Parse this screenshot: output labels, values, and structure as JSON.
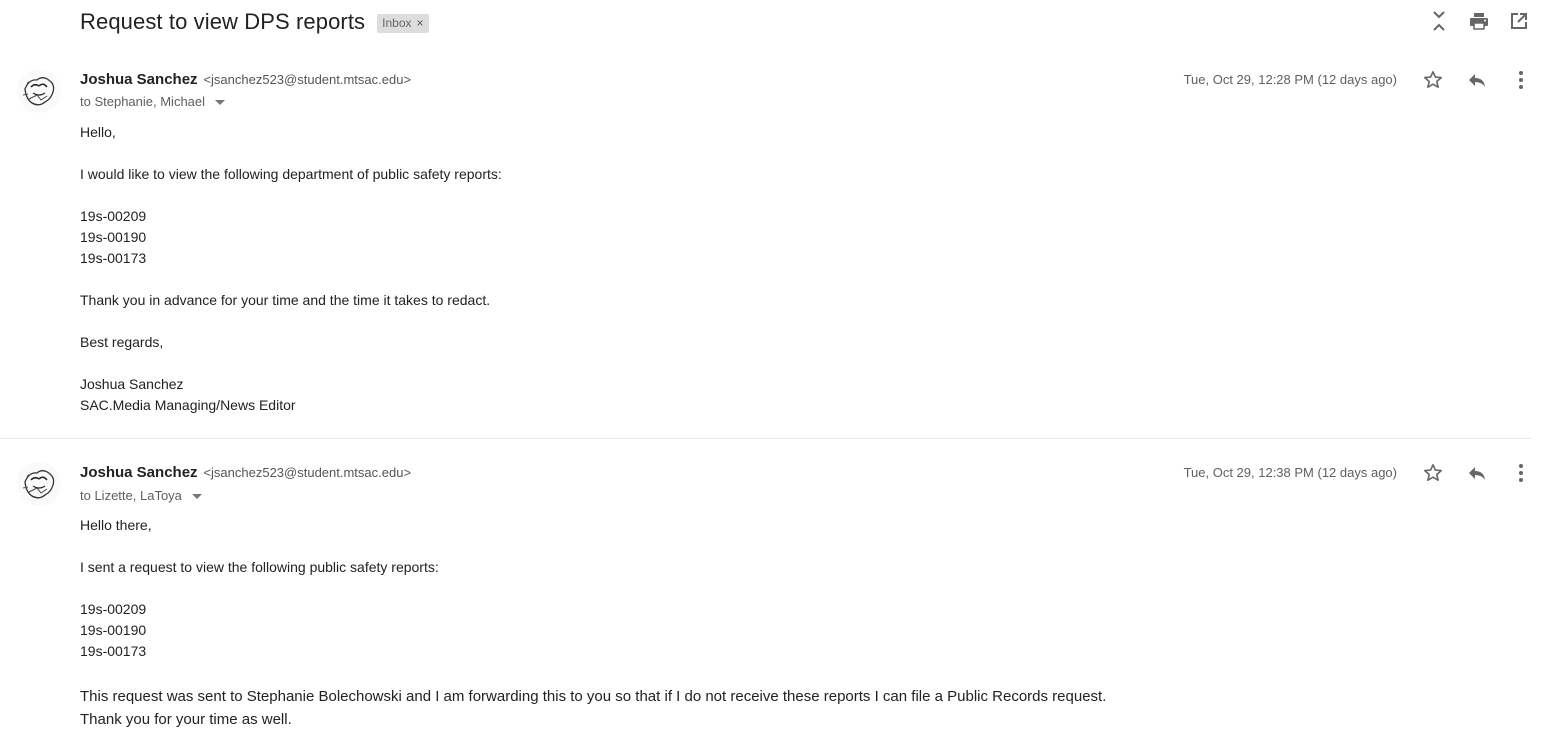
{
  "thread": {
    "subject": "Request to view DPS reports",
    "label": "Inbox"
  },
  "messages": [
    {
      "sender_name": "Joshua Sanchez",
      "sender_email": "<jsanchez523@student.mtsac.edu>",
      "to": "to Stephanie, Michael",
      "date": "Tue, Oct 29, 12:28 PM (12 days ago)",
      "body": {
        "greeting": "Hello,",
        "intro": "I would like to view the following department of public safety reports:",
        "reports": [
          "19s-00209",
          "19s-00190",
          "19s-00173"
        ],
        "thanks": "Thank you in advance for your time and the time it takes to redact.",
        "closing": "Best regards,",
        "signature_name": "Joshua Sanchez",
        "signature_title": "SAC.Media Managing/News Editor"
      }
    },
    {
      "sender_name": "Joshua Sanchez",
      "sender_email": "<jsanchez523@student.mtsac.edu>",
      "to": "to Lizette, LaToya",
      "date": "Tue, Oct 29, 12:38 PM (12 days ago)",
      "body": {
        "greeting": "Hello there,",
        "intro": "I sent a request to view the following public safety reports:",
        "reports": [
          "19s-00209",
          "19s-00190",
          "19s-00173"
        ],
        "line1": "This request was sent to Stephanie Bolechowski and I am forwarding this to you so that if I do not receive these reports I can file a Public Records request.",
        "line2": "Thank you for your time as well."
      }
    }
  ],
  "icons": {
    "collapse": "collapse-all-icon",
    "print": "print-icon",
    "open_new": "open-in-new-window-icon",
    "star": "star-icon",
    "reply": "reply-icon",
    "more": "more-vertical-icon"
  }
}
